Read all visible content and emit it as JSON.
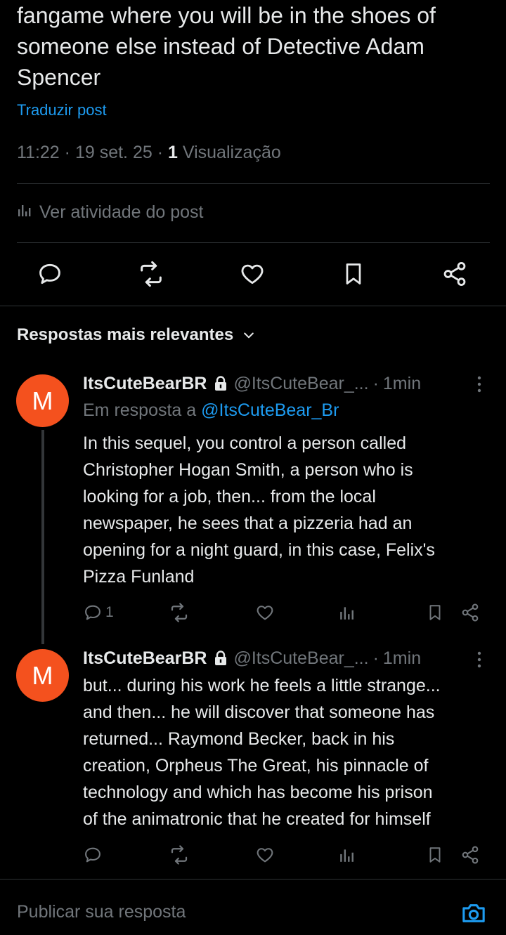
{
  "post": {
    "text": "fangame where you will be in the shoes of\nsomeone else instead of Detective Adam\nSpencer",
    "translate_label": "Traduzir post",
    "time": "11:22",
    "date": "19 set. 25",
    "views_count": "1",
    "views_label": "Visualização",
    "activity_label": "Ver atividade do post"
  },
  "replies_sort": {
    "label": "Respostas mais relevantes"
  },
  "replies": [
    {
      "avatar_letter": "M",
      "name": "ItsCuteBearBR",
      "handle": "@ItsCuteBear_...",
      "time": "1min",
      "reply_to_label": "Em resposta a",
      "reply_to_handle": "@ItsCuteBear_Br",
      "text": "In this sequel, you control a person called\nChristopher Hogan Smith, a person who is\nlooking for a job, then... from the local\nnewspaper, he sees that a pizzeria had an\nopening for a night guard, in this case, Felix's\nPizza Funland",
      "reply_count": "1"
    },
    {
      "avatar_letter": "M",
      "name": "ItsCuteBearBR",
      "handle": "@ItsCuteBear_...",
      "time": "1min",
      "text": "but... during his work he feels a little strange...\nand then... he will discover that someone has\nreturned... Raymond Becker, back in his\ncreation, Orpheus The Great, his pinnacle of\ntechnology and which has become his prison\nof the animatronic that he created for himself",
      "reply_count": ""
    }
  ],
  "composer": {
    "placeholder": "Publicar sua resposta"
  },
  "colors": {
    "background": "#000000",
    "text": "#e7e9ea",
    "muted": "#71767b",
    "accent": "#1d9bf0",
    "avatar": "#f4511e",
    "divider": "#2f3336"
  }
}
